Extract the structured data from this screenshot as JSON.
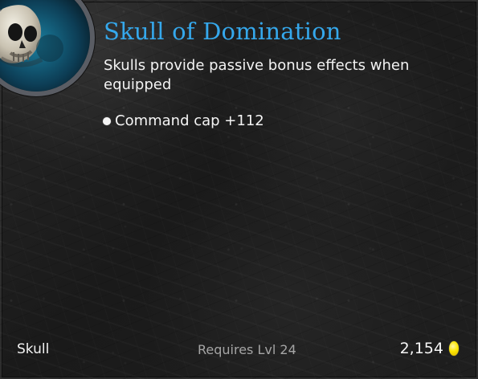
{
  "item": {
    "name": "Skull of Domination",
    "description": "Skulls provide passive bonus effects when equipped",
    "bonuses": [
      "Command cap +112"
    ],
    "type": "Skull",
    "requirement": "Requires Lvl 24",
    "price": "2,154"
  },
  "icons": {
    "portrait": "skull-portrait-icon",
    "bullet": "bullet-icon",
    "currency": "gold-coin-icon"
  },
  "colors": {
    "title": "#35a8ec",
    "text": "#f3f3f3",
    "muted": "#a5a5a5",
    "gold": "#ffe700",
    "background": "#1f1f1f"
  }
}
